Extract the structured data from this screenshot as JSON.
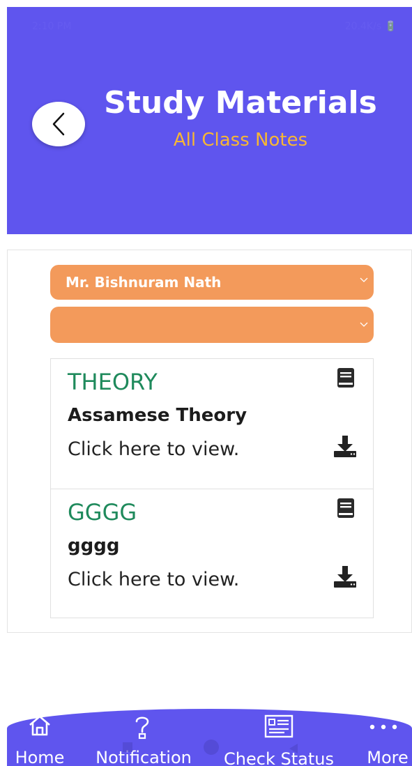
{
  "status_bar": {
    "time": "2:10 PM",
    "right": "20.4K/s 🔋"
  },
  "header": {
    "title": "Study Materials",
    "subtitle": "All Class Notes"
  },
  "filters": {
    "teacher_selected": "Mr. Bishnuram Nath",
    "subject_selected": ""
  },
  "notes": [
    {
      "category": "THEORY",
      "subject": "Assamese Theory",
      "action": "Click here to view."
    },
    {
      "category": "GGGG",
      "subject": "gggg",
      "action": "Click here to view."
    }
  ],
  "nav": {
    "home": "Home",
    "notification": "Notification",
    "check_status": "Check Status",
    "more": "More"
  },
  "colors": {
    "primary": "#5f55ee",
    "accent": "#f7b733",
    "select_bg": "#f39a5b",
    "category_green": "#1f8a5c"
  }
}
